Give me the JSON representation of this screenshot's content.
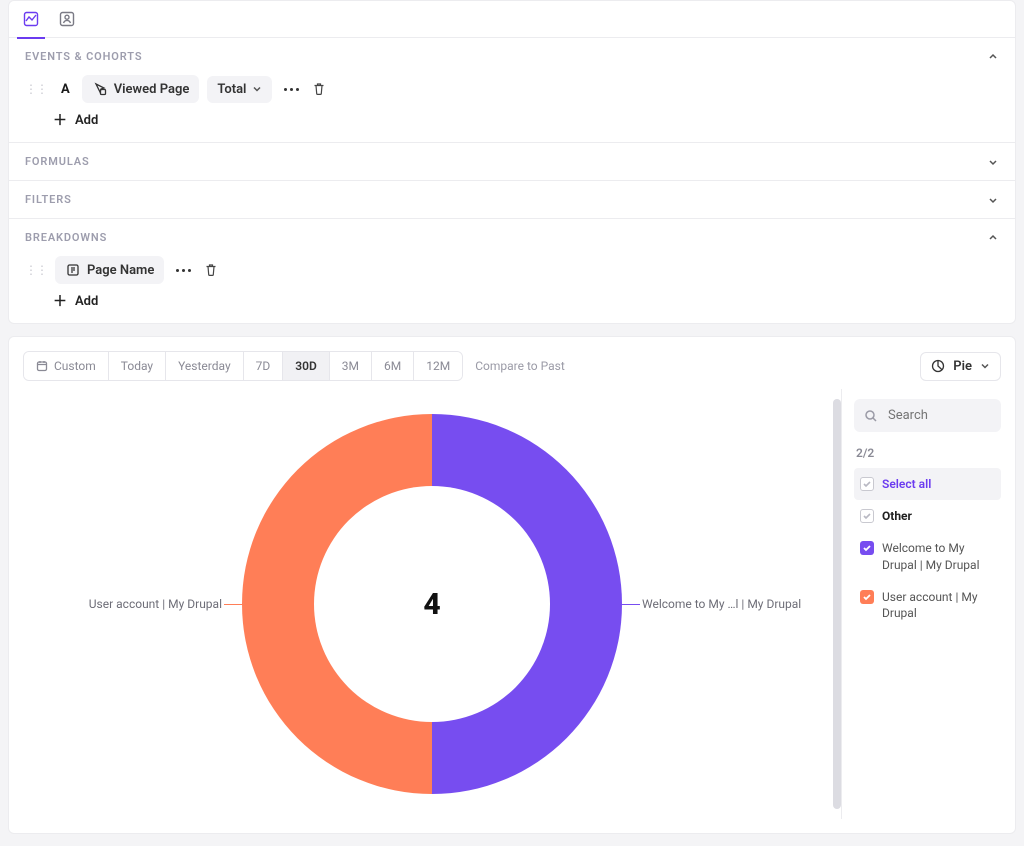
{
  "sections": {
    "events": {
      "title": "EVENTS & COHORTS",
      "series_letter": "A",
      "event_chip": "Viewed Page",
      "measure_chip": "Total",
      "add_label": "Add"
    },
    "formulas": {
      "title": "FORMULAS"
    },
    "filters": {
      "title": "FILTERS"
    },
    "breakdowns": {
      "title": "BREAKDOWNS",
      "prop_chip": "Page Name",
      "add_label": "Add"
    }
  },
  "toolbar": {
    "ranges": [
      "Custom",
      "Today",
      "Yesterday",
      "7D",
      "30D",
      "3M",
      "6M",
      "12M"
    ],
    "active_range": "30D",
    "compare_label": "Compare to Past",
    "viz_label": "Pie"
  },
  "legend": {
    "search_placeholder": "Search",
    "count_text": "2/2",
    "select_all": "Select all",
    "other": "Other",
    "items": [
      {
        "label": "Welcome to My Drupal | My Drupal",
        "color": "#774df0"
      },
      {
        "label": "User account | My Drupal",
        "color": "#ff7e57"
      }
    ]
  },
  "chart_labels": {
    "left": "User account | My Drupal",
    "right": "Welcome to My …l | My Drupal",
    "center": "4"
  },
  "chart_data": {
    "type": "pie",
    "title": "",
    "total_center_value": 4,
    "series": [
      {
        "name": "Welcome to My Drupal | My Drupal",
        "value": 2,
        "percent": 50,
        "color": "#774df0"
      },
      {
        "name": "User account | My Drupal",
        "value": 2,
        "percent": 50,
        "color": "#ff7e57"
      }
    ],
    "note": "Two equal halves; center shows total count 4 (≈2 events each)."
  },
  "colors": {
    "slice1": "#774df0",
    "slice2": "#ff7e57",
    "accent": "#6b3bf0"
  }
}
